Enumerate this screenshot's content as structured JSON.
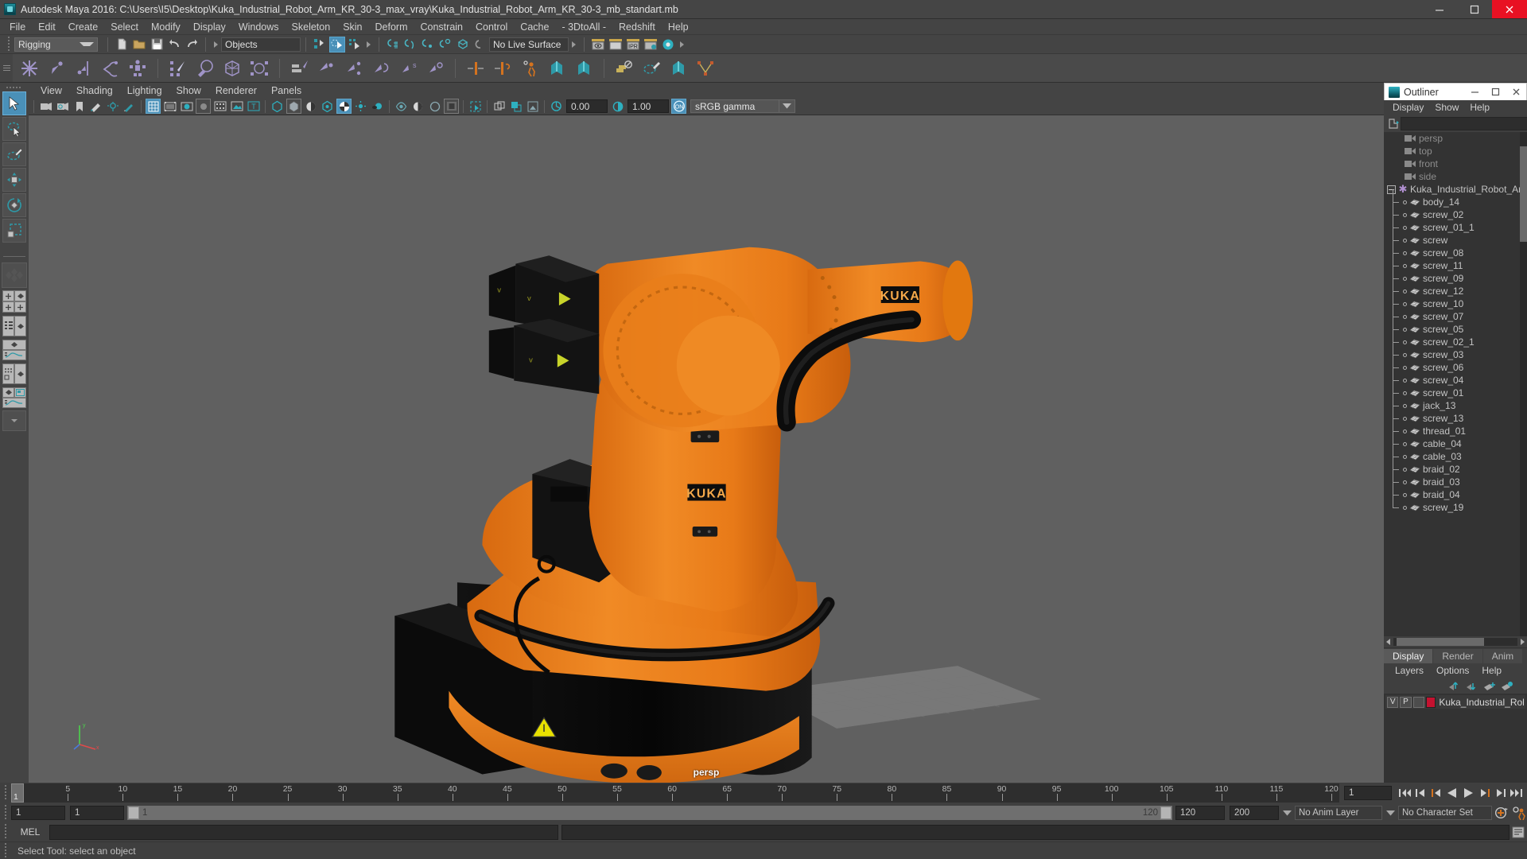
{
  "window": {
    "title": "Autodesk Maya 2016: C:\\Users\\I5\\Desktop\\Kuka_Industrial_Robot_Arm_KR_30-3_max_vray\\Kuka_Industrial_Robot_Arm_KR_30-3_mb_standart.mb",
    "app_icon": "maya-icon",
    "minimize": "minimize-icon",
    "maximize": "maximize-icon",
    "close": "close-icon"
  },
  "menubar": [
    "File",
    "Edit",
    "Create",
    "Select",
    "Modify",
    "Display",
    "Windows",
    "Skeleton",
    "Skin",
    "Deform",
    "Constrain",
    "Control",
    "Cache",
    "- 3DtoAll -",
    "Redshift",
    "Help"
  ],
  "statusline": {
    "menuset": "Rigging",
    "selection_mask": "Objects",
    "live_surface": "No Live Surface",
    "icons": [
      "new-scene-icon",
      "open-scene-icon",
      "save-scene-icon",
      "undo-icon",
      "redo-icon",
      "select-by-hierarchy-icon",
      "select-by-object-icon",
      "select-by-component-icon",
      "snap-to-grid-icon",
      "snap-to-curve-icon",
      "snap-to-point-icon",
      "snap-to-projected-center-icon",
      "snap-to-view-plane-icon",
      "make-live-icon",
      "render-current-frame-icon",
      "render-sequence-icon",
      "ipr-render-icon",
      "render-settings-icon",
      "hypershade-icon"
    ]
  },
  "shelf": {
    "icons": [
      "joint-tool-icon",
      "ik-handle-icon",
      "ik-spline-handle-icon",
      "ik-solver-icon",
      "quick-rig-icon",
      "bind-skin-icon",
      "paint-skin-weights-icon",
      "lattice-icon",
      "cluster-icon",
      "blend-shape-icon",
      "parent-constraint-icon",
      "point-constraint-icon",
      "orient-constraint-icon",
      "scale-constraint-icon",
      "aim-constraint-icon",
      "pole-vector-icon",
      "mirror-joint-icon",
      "connect-joint-icon",
      "hik-character-icon",
      "skeleton-a-icon",
      "skeleton-b-icon",
      "copy-skin-weights-icon",
      "paint-weights-icon",
      "skeleton-c-icon",
      "set-key-icon"
    ]
  },
  "toolbox": {
    "tools": [
      "select-tool-icon",
      "lasso-select-tool-icon",
      "paint-select-tool-icon",
      "move-tool-icon",
      "rotate-tool-icon",
      "scale-tool-icon"
    ],
    "layouts": [
      "single-perspective-layout-icon",
      "four-view-layout-icon",
      "outliner-persp-layout-icon",
      "persp-graph-layout-icon",
      "hypershade-persp-layout-icon",
      "persp-graph-outliner-layout-icon",
      "more-layouts-icon"
    ]
  },
  "viewport": {
    "menus": [
      "View",
      "Shading",
      "Lighting",
      "Show",
      "Renderer",
      "Panels"
    ],
    "camera_label": "persp",
    "exposure": "0.00",
    "gamma": "1.00",
    "view_transform": "sRGB gamma",
    "view_transform_enabled": "ON",
    "toolbar_icons": [
      "select-camera-icon",
      "camera-attributes-icon",
      "bookmark-icon",
      "image-plane-icon",
      "two-sided-lighting-icon",
      "grease-pencil-icon",
      "wireframe-icon",
      "smooth-shade-all-icon",
      "smooth-shade-selected-icon",
      "flat-shade-icon",
      "wireframe-on-shaded-icon",
      "textured-icon",
      "use-default-material-icon",
      "xray-icon",
      "xray-joints-icon",
      "xray-active-components-icon",
      "shadows-icon",
      "screen-space-ao-icon",
      "motion-blur-icon",
      "multisample-aa-icon",
      "depth-of-field-icon",
      "isolate-select-icon",
      "grid-toggle-icon",
      "film-gate-icon",
      "resolution-gate-icon",
      "gate-mask-icon"
    ],
    "background_color": "#606060",
    "model": "kuka-industrial-robot-arm",
    "model_brand": "KUKA",
    "model_color": "#ec7a17"
  },
  "outliner": {
    "window_title": "Outliner",
    "menus": [
      "Display",
      "Show",
      "Help"
    ],
    "search_placeholder": "",
    "items": [
      {
        "label": "persp",
        "icon": "camera-icon",
        "indent": 1,
        "style": "dim"
      },
      {
        "label": "top",
        "icon": "camera-icon",
        "indent": 1,
        "style": "dim"
      },
      {
        "label": "front",
        "icon": "camera-icon",
        "indent": 1,
        "style": "dim"
      },
      {
        "label": "side",
        "icon": "camera-icon",
        "indent": 1,
        "style": "dim"
      },
      {
        "label": "Kuka_Industrial_Robot_Arm_",
        "icon": "group-icon",
        "indent": 0,
        "style": "root",
        "expanded": true
      },
      {
        "label": "body_14",
        "icon": "mesh-icon",
        "indent": 2,
        "style": "child"
      },
      {
        "label": "screw_02",
        "icon": "mesh-icon",
        "indent": 2,
        "style": "child"
      },
      {
        "label": "screw_01_1",
        "icon": "mesh-icon",
        "indent": 2,
        "style": "child"
      },
      {
        "label": "screw",
        "icon": "mesh-icon",
        "indent": 2,
        "style": "child"
      },
      {
        "label": "screw_08",
        "icon": "mesh-icon",
        "indent": 2,
        "style": "child"
      },
      {
        "label": "screw_11",
        "icon": "mesh-icon",
        "indent": 2,
        "style": "child"
      },
      {
        "label": "screw_09",
        "icon": "mesh-icon",
        "indent": 2,
        "style": "child"
      },
      {
        "label": "screw_12",
        "icon": "mesh-icon",
        "indent": 2,
        "style": "child"
      },
      {
        "label": "screw_10",
        "icon": "mesh-icon",
        "indent": 2,
        "style": "child"
      },
      {
        "label": "screw_07",
        "icon": "mesh-icon",
        "indent": 2,
        "style": "child"
      },
      {
        "label": "screw_05",
        "icon": "mesh-icon",
        "indent": 2,
        "style": "child"
      },
      {
        "label": "screw_02_1",
        "icon": "mesh-icon",
        "indent": 2,
        "style": "child"
      },
      {
        "label": "screw_03",
        "icon": "mesh-icon",
        "indent": 2,
        "style": "child"
      },
      {
        "label": "screw_06",
        "icon": "mesh-icon",
        "indent": 2,
        "style": "child"
      },
      {
        "label": "screw_04",
        "icon": "mesh-icon",
        "indent": 2,
        "style": "child"
      },
      {
        "label": "screw_01",
        "icon": "mesh-icon",
        "indent": 2,
        "style": "child"
      },
      {
        "label": "jack_13",
        "icon": "mesh-icon",
        "indent": 2,
        "style": "child"
      },
      {
        "label": "screw_13",
        "icon": "mesh-icon",
        "indent": 2,
        "style": "child"
      },
      {
        "label": "thread_01",
        "icon": "mesh-icon",
        "indent": 2,
        "style": "child"
      },
      {
        "label": "cable_04",
        "icon": "mesh-icon",
        "indent": 2,
        "style": "child"
      },
      {
        "label": "cable_03",
        "icon": "mesh-icon",
        "indent": 2,
        "style": "child"
      },
      {
        "label": "braid_02",
        "icon": "mesh-icon",
        "indent": 2,
        "style": "child"
      },
      {
        "label": "braid_03",
        "icon": "mesh-icon",
        "indent": 2,
        "style": "child"
      },
      {
        "label": "braid_04",
        "icon": "mesh-icon",
        "indent": 2,
        "style": "child"
      },
      {
        "label": "screw_19",
        "icon": "mesh-icon",
        "indent": 2,
        "style": "child"
      }
    ]
  },
  "layer_editor": {
    "tabs": [
      {
        "label": "Display",
        "active": true
      },
      {
        "label": "Render",
        "active": false
      },
      {
        "label": "Anim",
        "active": false
      }
    ],
    "menus": [
      "Layers",
      "Options",
      "Help"
    ],
    "tool_icons": [
      "move-layer-up-icon",
      "move-layer-down-icon",
      "new-layer-icon",
      "new-layer-from-selected-icon"
    ],
    "layers": [
      {
        "visibility": "V",
        "playback": "P",
        "shading": "",
        "color": "#c41230",
        "name": "Kuka_Industrial_Robot"
      }
    ]
  },
  "timeline": {
    "ticks": [
      5,
      10,
      15,
      20,
      25,
      30,
      35,
      40,
      45,
      50,
      55,
      60,
      65,
      70,
      75,
      80,
      85,
      90,
      95,
      100,
      105,
      110,
      115,
      120
    ],
    "range_start": 1,
    "range_end": 120,
    "current_frame": "1",
    "current_frame_field": "1",
    "playback_icons": [
      "go-to-start-icon",
      "step-back-frame-icon",
      "step-back-key-icon",
      "play-backwards-icon",
      "play-forwards-icon",
      "step-forward-key-icon",
      "step-forward-frame-icon",
      "go-to-end-icon"
    ]
  },
  "rangeslider": {
    "anim_start": "1",
    "playback_start": "1",
    "bar_start_label": "1",
    "bar_end_label": "120",
    "playback_end": "120",
    "anim_end": "200",
    "anim_layer": "No Anim Layer",
    "character_set": "No Character Set",
    "auto_key_icon": "auto-keyframe-icon",
    "anim_prefs_icon": "animation-preferences-icon"
  },
  "commandline": {
    "language": "MEL",
    "input_value": "",
    "output_value": "",
    "script_editor_icon": "script-editor-icon"
  },
  "helpline": {
    "message": "Select Tool: select an object"
  },
  "colors": {
    "accent_blue": "#4a90b8",
    "shelf_purple": "#a094c8",
    "shelf_teal": "#2e9aa8",
    "shelf_orange": "#d4731f",
    "robot_orange": "#ec7a17",
    "layer_red": "#c41230",
    "title_red": "#e81123"
  }
}
